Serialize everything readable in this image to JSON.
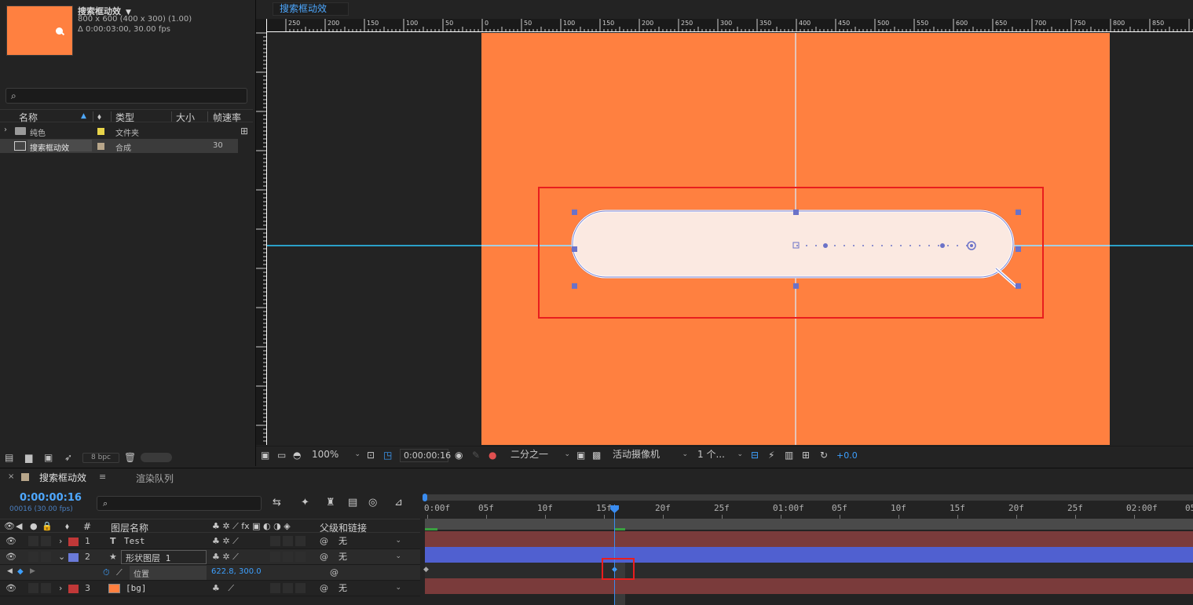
{
  "project": {
    "comp_name": "搜索框动效",
    "comp_size": "800 x 600  (400 x 300) (1.00)",
    "comp_duration": "Δ 0:00:03:00, 30.00 fps",
    "columns": {
      "name": "名称",
      "type": "类型",
      "size": "大小",
      "fps": "帧速率"
    },
    "items": [
      {
        "name": "纯色",
        "type": "文件夹",
        "fps": "",
        "label_color": "#e8d44a"
      },
      {
        "name": "搜索框动效",
        "type": "合成",
        "fps": "30",
        "label_color": "#b8a68a"
      }
    ],
    "bpc": "8 bpc"
  },
  "viewer": {
    "tab": "搜索框动效",
    "ruler_labels": [
      "250",
      "200",
      "150",
      "100",
      "50",
      "0",
      "50",
      "100",
      "150",
      "200",
      "250",
      "300",
      "350",
      "400",
      "450",
      "500",
      "550",
      "600",
      "650",
      "700",
      "750",
      "800",
      "850"
    ],
    "zoom": "100%",
    "timecode": "0:00:00:16",
    "resolution": "二分之一",
    "camera": "活动摄像机",
    "views": "1 个...",
    "exposure": "+0.0",
    "comp_color": "#ff8040"
  },
  "timeline": {
    "tab_active": "搜索框动效",
    "tab_render": "渲染队列",
    "current_time": "0:00:00:16",
    "frames_label": "00016 (30.00 fps)",
    "col_layer_name": "图层名称",
    "col_hash": "#",
    "col_parent": "父级和链接",
    "layers": [
      {
        "num": "1",
        "type_icon": "T",
        "name": "Test",
        "parent": "无",
        "label_color": "#c03838"
      },
      {
        "num": "2",
        "type_icon": "★",
        "name": "形状图层 1",
        "parent": "无",
        "label_color": "#6a7ad8"
      },
      {
        "num": "3",
        "type_icon": "",
        "name": "[bg]",
        "parent": "无",
        "label_color": "#c03838"
      }
    ],
    "property": {
      "name": "位置",
      "value": "622.8, 300.0"
    },
    "ruler": [
      "0:00f",
      "05f",
      "10f",
      "15f",
      "20f",
      "25f",
      "01:00f",
      "05f",
      "10f",
      "15f",
      "20f",
      "25f",
      "02:00f",
      "05"
    ]
  }
}
